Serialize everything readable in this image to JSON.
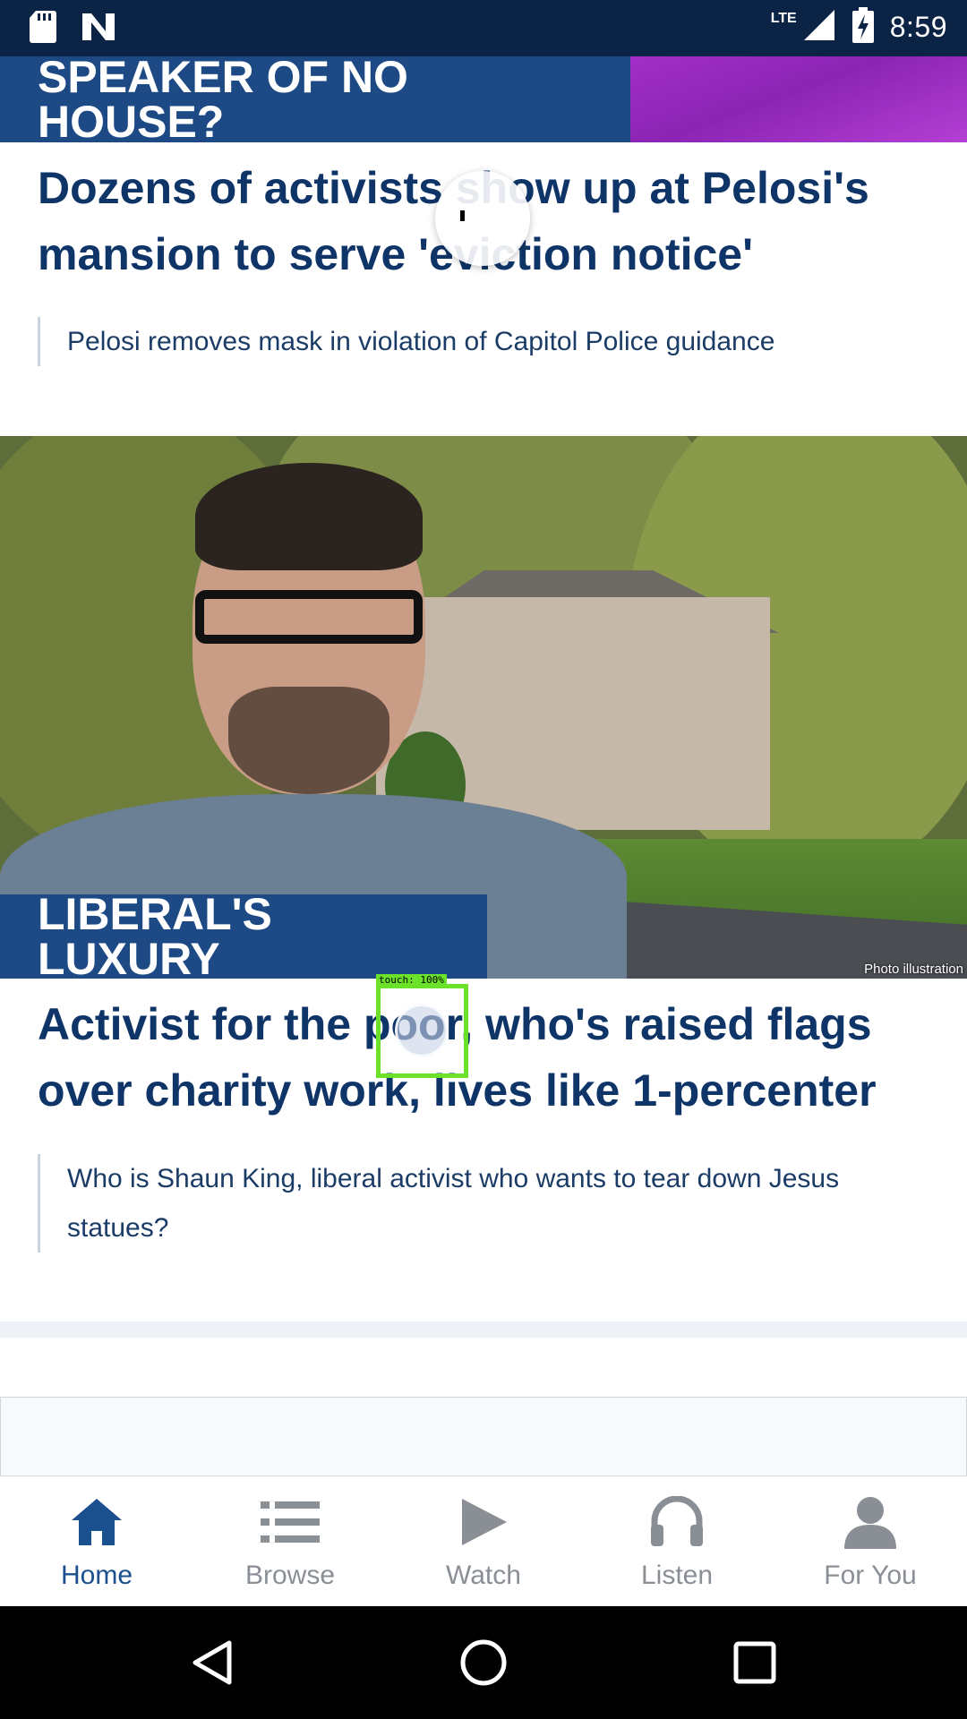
{
  "status_bar": {
    "time": "8:59",
    "network": "LTE",
    "icons": [
      "sd-card-icon",
      "n-logo-icon",
      "signal-icon",
      "battery-charging-icon"
    ]
  },
  "stories": [
    {
      "kicker": "SPEAKER OF NO HOUSE?",
      "headline": "Dozens of activists show up at Pelosi's mansion to serve 'eviction notice'",
      "related": "Pelosi removes mask in violation of Capitol Police guidance"
    },
    {
      "kicker": "LIBERAL'S LUXURY",
      "photo_credit": "Photo illustration",
      "headline": "Activist for the poor, who's raised flags over charity work, lives like 1-percenter",
      "related": "Who is Shaun King, liberal activist who wants to tear down Jesus statues?"
    }
  ],
  "bottom_nav": {
    "items": [
      {
        "label": "Home",
        "icon": "home-icon",
        "active": true
      },
      {
        "label": "Browse",
        "icon": "list-icon",
        "active": false
      },
      {
        "label": "Watch",
        "icon": "play-icon",
        "active": false
      },
      {
        "label": "Listen",
        "icon": "headphones-icon",
        "active": false
      },
      {
        "label": "For You",
        "icon": "person-icon",
        "active": false
      }
    ]
  },
  "touch_overlay": {
    "label": "touch: 100%"
  },
  "colors": {
    "navy": "#0b2344",
    "kicker_bg": "#1d4a85",
    "headline": "#0f3568",
    "nav_active": "#1b4f8e",
    "nav_inactive": "#8a8f96",
    "touch": "#6be12a"
  }
}
